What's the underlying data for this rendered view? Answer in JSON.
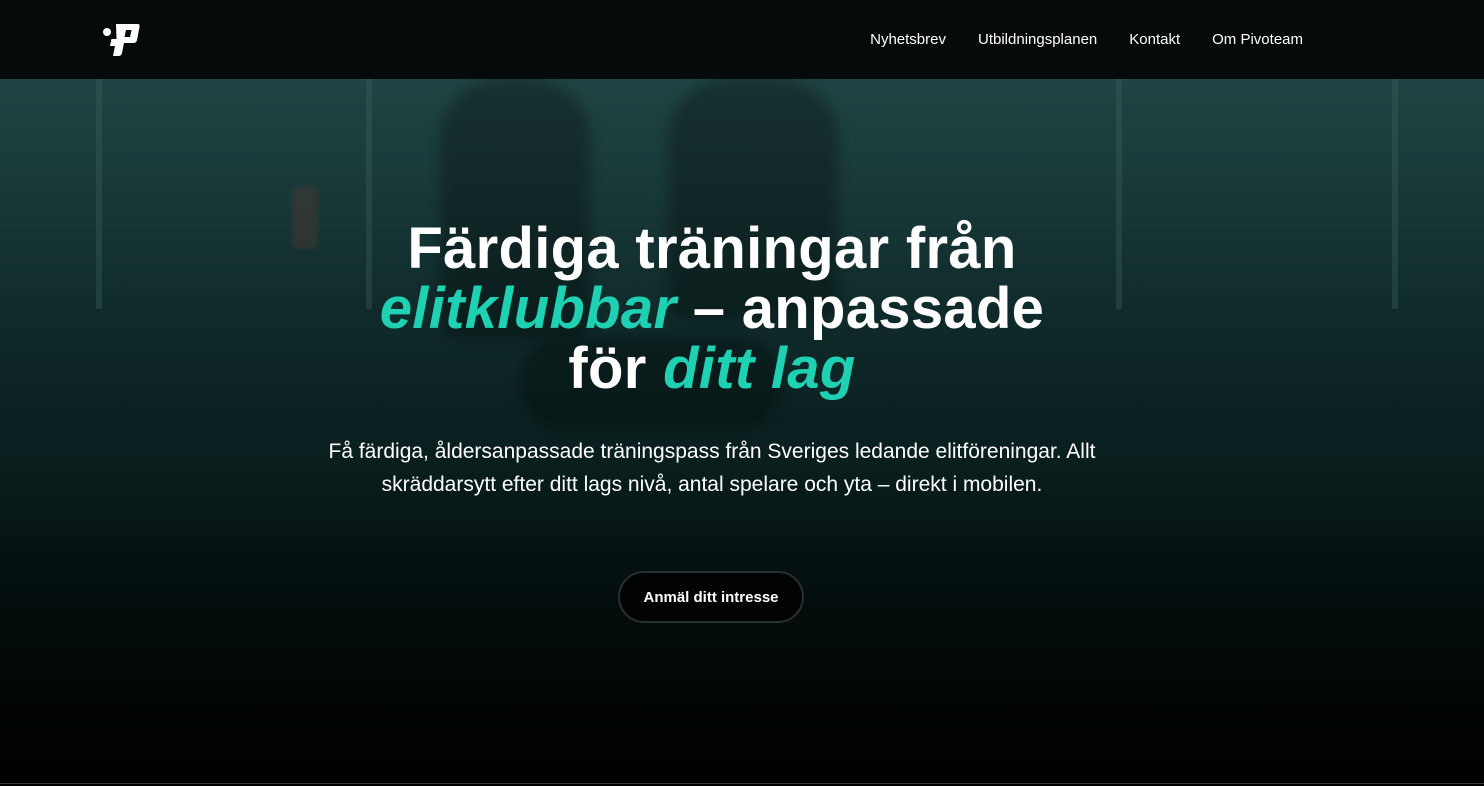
{
  "nav": {
    "logo_name": "pivoteam-logo",
    "links": [
      {
        "label": "Nyhetsbrev"
      },
      {
        "label": "Utbildningsplanen"
      },
      {
        "label": "Kontakt"
      },
      {
        "label": "Om Pivoteam"
      }
    ]
  },
  "hero": {
    "headline_part1": "Färdiga träningar från",
    "headline_accent1": "elitklubbar",
    "headline_part2": " – anpassade",
    "headline_part3": "för ",
    "headline_accent2": "ditt lag",
    "subtext": "Få färdiga, åldersanpassade träningspass från Sveriges ledande elitföreningar. Allt skräddarsytt efter ditt lags nivå, antal spelare och yta – direkt i mobilen.",
    "cta_label": "Anmäl ditt intresse"
  },
  "colors": {
    "accent": "#1ed1b2",
    "nav_bg": "#060a0a",
    "text": "#ffffff"
  }
}
